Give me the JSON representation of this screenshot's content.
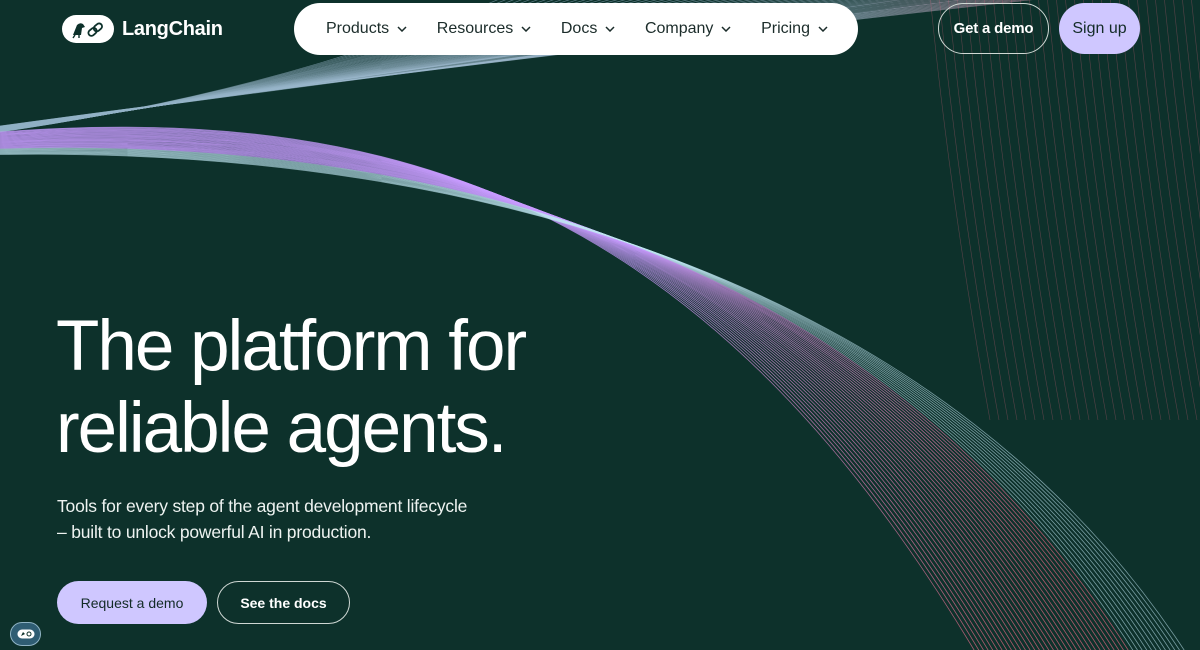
{
  "brand": {
    "name": "LangChain",
    "logo_icon": "parrot-link-icon"
  },
  "nav": {
    "items": [
      {
        "label": "Products"
      },
      {
        "label": "Resources"
      },
      {
        "label": "Docs"
      },
      {
        "label": "Company"
      },
      {
        "label": "Pricing"
      }
    ]
  },
  "header_actions": {
    "demo_label": "Get a demo",
    "signup_label": "Sign up"
  },
  "hero": {
    "headline_line1": "The platform for",
    "headline_line2": "reliable agents.",
    "sub_line1": "Tools for every step of the agent development lifecycle",
    "sub_line2": "– built to unlock powerful AI in production.",
    "primary_cta": "Request a demo",
    "secondary_cta": "See the docs"
  },
  "colors": {
    "background": "#0d312b",
    "accent": "#cfc7ff",
    "line_purple": "#c89bff",
    "line_pink": "#e2657f",
    "line_cyan": "#bfe6f2"
  },
  "icons": {
    "corner_widget": "parrot-widget-icon",
    "nav_chevron": "chevron-down-icon"
  }
}
